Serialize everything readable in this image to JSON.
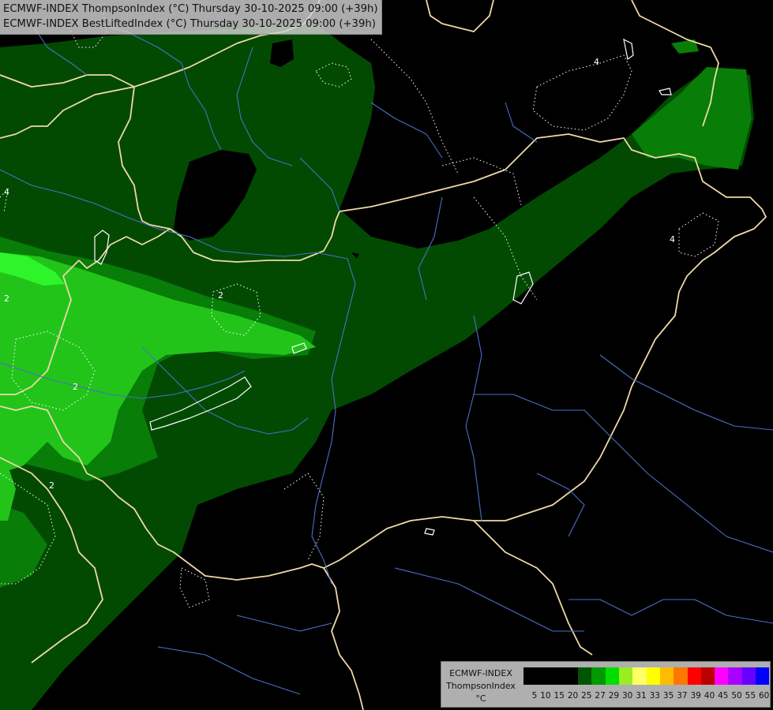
{
  "header": {
    "line1": "ECMWF-INDEX ThompsonIndex (°C) Thursday 30-10-2025 09:00 (+39h)",
    "line2": "ECMWF-INDEX BestLiftedIndex (°C) Thursday 30-10-2025 09:00 (+39h)"
  },
  "legend": {
    "model": "ECMWF-INDEX",
    "parameter": "ThompsonIndex",
    "unit": "°C",
    "ticks": [
      "5",
      "10",
      "15",
      "20",
      "25",
      "27",
      "29",
      "30",
      "31",
      "33",
      "35",
      "37",
      "39",
      "40",
      "45",
      "50",
      "55",
      "60"
    ],
    "colors": [
      "#000000",
      "#000000",
      "#000000",
      "#000000",
      "#005500",
      "#009900",
      "#00dd00",
      "#99ee22",
      "#ffff66",
      "#ffff00",
      "#ffbb00",
      "#ff7700",
      "#ff0000",
      "#bb0000",
      "#ff00ff",
      "#aa00ff",
      "#6600ff",
      "#0000ff"
    ]
  },
  "map": {
    "field_colors": {
      "background": "#000000",
      "level_20": "#024a02",
      "level_25": "#087d08",
      "level_27": "#22c41a",
      "level_29": "#2ef52a"
    },
    "border_color": "#f0d8a8",
    "river_color": "#4a6fc4",
    "contour_color": "#ffffff",
    "contour_labels": [
      "2",
      "2",
      "2",
      "2",
      "4",
      "4",
      "4"
    ]
  }
}
